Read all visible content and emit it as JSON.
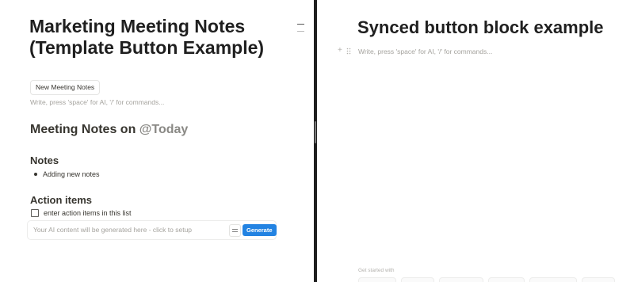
{
  "left_page": {
    "title": "Marketing Meeting Notes (Template Button Example)",
    "template_button_label": "New Meeting Notes",
    "placeholder": "Write, press 'space' for AI, '/' for commands...",
    "meeting_heading_prefix": "Meeting Notes on ",
    "meeting_date_mention": "@Today",
    "notes_heading": "Notes",
    "notes_items": [
      "Adding new notes"
    ],
    "action_items_heading": "Action items",
    "todo_items": [
      {
        "label": "enter action items in this list",
        "checked": false
      }
    ],
    "ai_block": {
      "placeholder": "Your AI content will be generated here - click to setup",
      "generate_label": "Generate"
    }
  },
  "right_page": {
    "title": "Synced button block example",
    "placeholder": "Write, press 'space' for AI, '/' for commands...",
    "get_started_label": "Get started with"
  },
  "colors": {
    "accent": "#2383e2",
    "divider": "#1f1f1f",
    "placeholder_text": "#a5a39e",
    "mention_text": "#8a8985"
  }
}
